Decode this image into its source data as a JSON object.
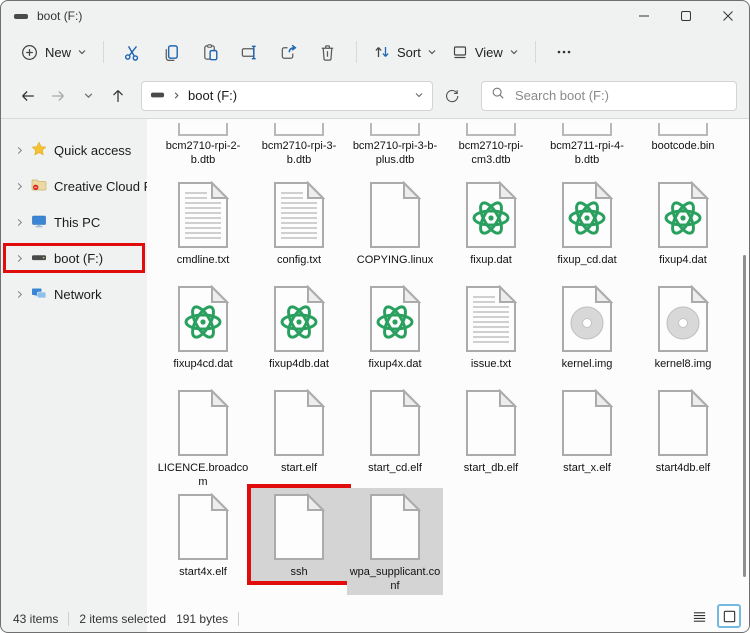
{
  "window": {
    "title": "boot (F:)"
  },
  "toolbar": {
    "new_label": "New",
    "sort_label": "Sort",
    "view_label": "View"
  },
  "navbar": {
    "breadcrumb": "boot (F:)",
    "search_placeholder": "Search boot (F:)"
  },
  "sidebar": {
    "items": [
      {
        "label": "Quick access",
        "icon": "star-icon"
      },
      {
        "label": "Creative Cloud Files",
        "icon": "creative-cloud-folder-icon"
      },
      {
        "label": "This PC",
        "icon": "monitor-icon"
      },
      {
        "label": "boot (F:)",
        "icon": "drive-icon"
      },
      {
        "label": "Network",
        "icon": "network-icon"
      }
    ]
  },
  "files": {
    "items": [
      {
        "name": "bcm2710-rpi-2-b.dtb",
        "icon": "partial"
      },
      {
        "name": "bcm2710-rpi-3-b.dtb",
        "icon": "partial"
      },
      {
        "name": "bcm2710-rpi-3-b-plus.dtb",
        "icon": "partial"
      },
      {
        "name": "bcm2710-rpi-cm3.dtb",
        "icon": "partial"
      },
      {
        "name": "bcm2711-rpi-4-b.dtb",
        "icon": "partial"
      },
      {
        "name": "bootcode.bin",
        "icon": "partial"
      },
      {
        "name": "cmdline.txt",
        "icon": "text"
      },
      {
        "name": "config.txt",
        "icon": "text"
      },
      {
        "name": "COPYING.linux",
        "icon": "blank"
      },
      {
        "name": "fixup.dat",
        "icon": "atom"
      },
      {
        "name": "fixup_cd.dat",
        "icon": "atom"
      },
      {
        "name": "fixup4.dat",
        "icon": "atom"
      },
      {
        "name": "fixup4cd.dat",
        "icon": "atom"
      },
      {
        "name": "fixup4db.dat",
        "icon": "atom"
      },
      {
        "name": "fixup4x.dat",
        "icon": "atom"
      },
      {
        "name": "issue.txt",
        "icon": "text"
      },
      {
        "name": "kernel.img",
        "icon": "disc"
      },
      {
        "name": "kernel8.img",
        "icon": "disc"
      },
      {
        "name": "LICENCE.broadcom",
        "icon": "blank"
      },
      {
        "name": "start.elf",
        "icon": "blank"
      },
      {
        "name": "start_cd.elf",
        "icon": "blank"
      },
      {
        "name": "start_db.elf",
        "icon": "blank"
      },
      {
        "name": "start_x.elf",
        "icon": "blank"
      },
      {
        "name": "start4db.elf",
        "icon": "blank"
      },
      {
        "name": "start4x.elf",
        "icon": "blank"
      },
      {
        "name": "ssh",
        "icon": "blank",
        "selected": true,
        "highlight": true
      },
      {
        "name": "wpa_supplicant.conf",
        "icon": "blank",
        "selected": true
      }
    ]
  },
  "statusbar": {
    "count": "43 items",
    "selected": "2 items selected",
    "size": "191 bytes"
  },
  "annotations": {
    "highlighted_sidebar_item": "boot (F:)",
    "highlighted_file": "ssh",
    "highlight_color": "#e10c0c"
  },
  "colors": {
    "accent_blue": "#1f66b0",
    "atom_green": "#2aa05f",
    "selection_gray": "#d4d4d4",
    "chrome_gray": "#f0f1f1"
  }
}
